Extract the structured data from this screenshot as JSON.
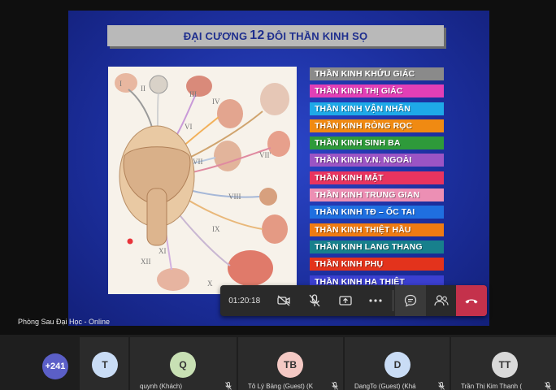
{
  "slide": {
    "title_prefix": "ĐẠI CƯƠNG",
    "title_number": "12",
    "title_suffix": "ĐÔI THẦN KINH SỌ",
    "figure_numerals": [
      "I",
      "II",
      "III",
      "IV",
      "VI",
      "VII",
      "VII'",
      "VIII",
      "IX",
      "XI",
      "XII",
      "X"
    ],
    "nerves": [
      {
        "label": "THẦN KINH KHỨU GIÁC",
        "color": "#8a8a8a"
      },
      {
        "label": "THẦN KINH THỊ GIÁC",
        "color": "#e23fb6"
      },
      {
        "label": "THẦN KINH VẬN NHÃN",
        "color": "#1ea9e8"
      },
      {
        "label": "THẦN KINH RÒNG RỌC",
        "color": "#f08a12"
      },
      {
        "label": "THẦN KINH SINH BA",
        "color": "#2e9a3a"
      },
      {
        "label": "THẦN KINH V.N. NGOÀI",
        "color": "#9b54c4"
      },
      {
        "label": "THẦN KINH MẶT",
        "color": "#e8345f"
      },
      {
        "label": "THẦN KINH TRUNG GIAN",
        "color": "#ec8fb4"
      },
      {
        "label": "THẦN KINH TĐ – ỐC TAI",
        "color": "#1f6fe0"
      },
      {
        "label": "THẦN KINH THIỆT HẦU",
        "color": "#ef7b12"
      },
      {
        "label": "THẦN KINH LANG THANG",
        "color": "#17808c"
      },
      {
        "label": "THẦN KINH PHỤ",
        "color": "#e3331c"
      },
      {
        "label": "THẦN KINH HẠ THIỆT",
        "color": "#3b3fd0"
      }
    ]
  },
  "room_label": "Phòng Sau Đại Học - Online",
  "call_controls": {
    "timer": "01:20:18",
    "buttons": [
      "camera-off-icon",
      "mic-off-icon",
      "share-screen-icon",
      "more-icon",
      "chat-icon",
      "people-icon",
      "hangup-icon"
    ]
  },
  "participants": {
    "overflow_count": "+241",
    "list": [
      {
        "initials": "T",
        "name": "",
        "avatar_color": "#c9dcf5"
      },
      {
        "initials": "Q",
        "name": "quynh (Khách)",
        "avatar_color": "#c8e0b4"
      },
      {
        "initials": "TB",
        "name": "Tô Lý Bảng (Guest) (K",
        "avatar_color": "#f4c9c4"
      },
      {
        "initials": "D",
        "name": "DangTo (Guest) (Khá",
        "avatar_color": "#c9dcf5"
      },
      {
        "initials": "TT",
        "name": "Trần Thị Kim Thanh (",
        "avatar_color": "#d9d9d9"
      }
    ]
  }
}
